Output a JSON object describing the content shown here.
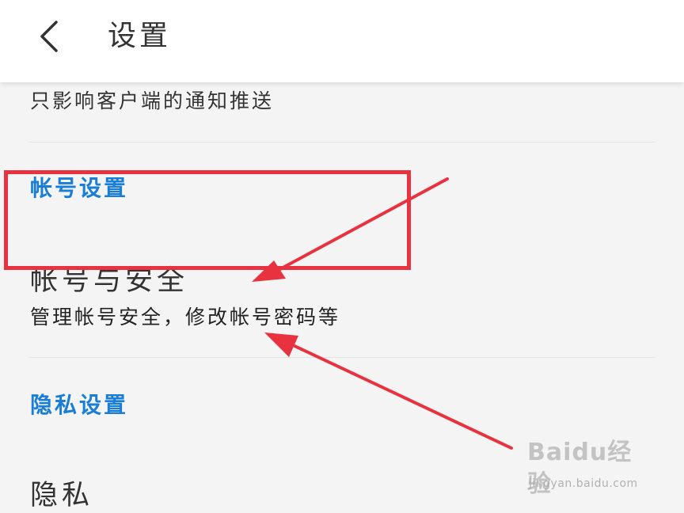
{
  "header": {
    "title": "设置",
    "back_icon": "chevron-left-icon"
  },
  "content": {
    "top_note": "只影响客户端的通知推送",
    "sections": [
      {
        "title": "帐号设置",
        "items": [
          {
            "title": "帐号与安全",
            "subtitle": "管理帐号安全，修改帐号密码等",
            "highlighted": true
          }
        ]
      },
      {
        "title": "隐私设置",
        "items": [
          {
            "title": "隐私"
          }
        ]
      }
    ]
  },
  "annotations": {
    "highlight_color": "#e8323f"
  },
  "watermark": {
    "logo": "Baidu经验",
    "url": "jingyan.baidu.com"
  },
  "colors": {
    "section_title": "#1a7ed6",
    "background": "#f4f4f4",
    "header_bg": "#ffffff"
  }
}
